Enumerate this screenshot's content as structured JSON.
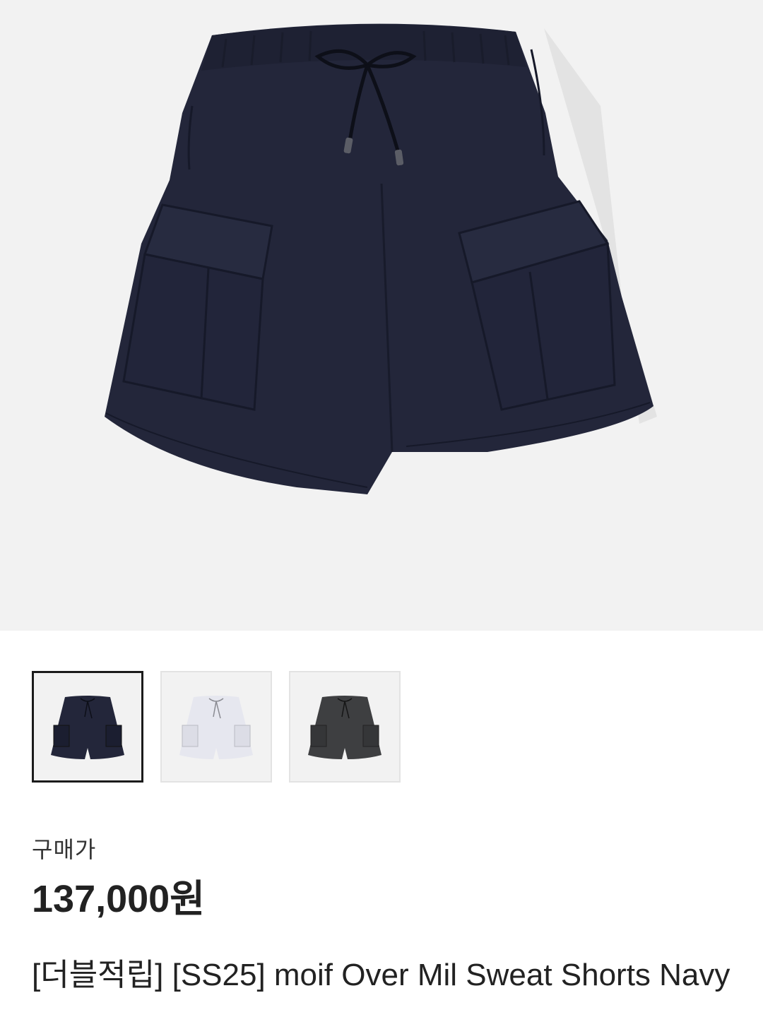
{
  "product": {
    "price_label": "구매가",
    "price": "137,000원",
    "title": "[더블적립] [SS25] moif Over Mil Sweat Shorts Navy"
  },
  "thumbnails": [
    {
      "color": "#23263a",
      "selected": true
    },
    {
      "color": "#e6e7ef",
      "selected": false
    },
    {
      "color": "#3e3f41",
      "selected": false
    }
  ],
  "colors": {
    "hero_background": "#f2f2f2",
    "product_navy": "#23263a",
    "text_primary": "#222222",
    "selected_border": "#1b1b1b"
  }
}
